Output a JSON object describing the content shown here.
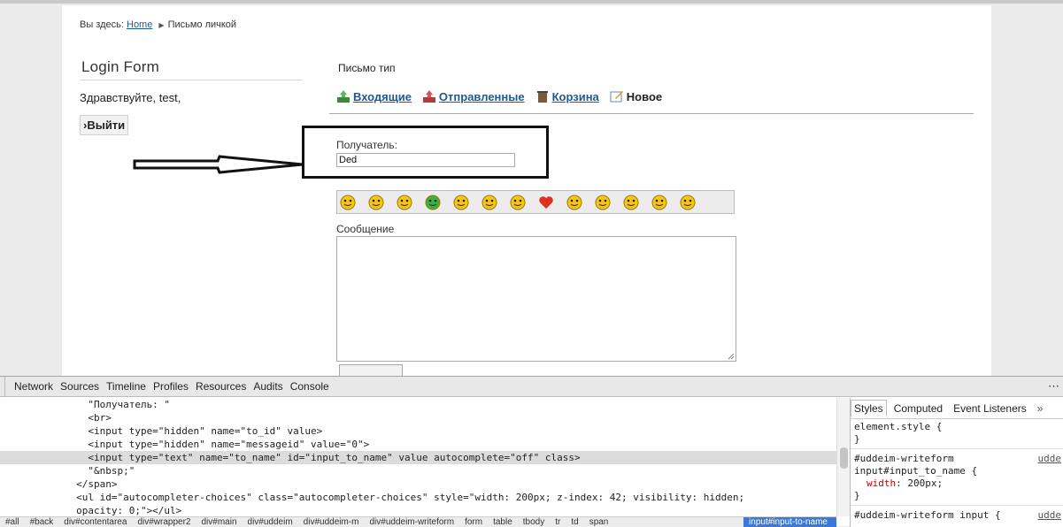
{
  "breadcrumb": {
    "prefix": "Вы здесь:",
    "home": "Home",
    "current": "Письмо личкой"
  },
  "login": {
    "title": "Login Form",
    "greeting": "Здравствуйте, test,",
    "logout": "›Выйти"
  },
  "message": {
    "type_label": "Письмо тип",
    "nav": {
      "inbox": "Входящие",
      "sent": "Отправленные",
      "trash": "Корзина",
      "new": "Новое"
    },
    "recipient_label": "Получатель:",
    "recipient_value": "Ded",
    "body_label": "Сообщение",
    "smileys": [
      "smile-face-icon",
      "wink-face-icon",
      "grin-face-icon",
      "green-alien-face-icon",
      "angry-face-icon",
      "sad-face-icon",
      "cool-sunglasses-face-icon",
      "heart-icon",
      "blush-face-icon",
      "thinking-face-icon",
      "surprised-face-icon",
      "happy-face-icon",
      "sleepy-face-icon"
    ]
  },
  "devtools": {
    "tabs": [
      "Network",
      "Sources",
      "Timeline",
      "Profiles",
      "Resources",
      "Audits",
      "Console"
    ],
    "elements": [
      {
        "indent": "               ",
        "text": "\"Получатель: \""
      },
      {
        "indent": "               ",
        "text": "<br>"
      },
      {
        "indent": "               ",
        "text": "<input type=\"hidden\" name=\"to_id\" value>"
      },
      {
        "indent": "               ",
        "text": "<input type=\"hidden\" name=\"messageid\" value=\"0\">"
      },
      {
        "indent": "               ",
        "text": "<input type=\"text\" name=\"to_name\" id=\"input_to_name\" value autocomplete=\"off\" class>"
      },
      {
        "indent": "               ",
        "text": "\"&nbsp;\""
      },
      {
        "indent": "             ",
        "text": "</span>"
      },
      {
        "indent": "             ",
        "text": "<ul id=\"autocompleter-choices\" class=\"autocompleter-choices\" style=\"width: 200px; z-index: 42; visibility: hidden;"
      },
      {
        "indent": "             ",
        "text": "opacity: 0;\"></ul>"
      }
    ],
    "crumbs": [
      "#all",
      "#back",
      "div#contentarea",
      "div#wrapper2",
      "div#main",
      "div#uddeim",
      "div#uddeim-m",
      "div#uddeim-writeform",
      "form",
      "table",
      "tbody",
      "tr",
      "td",
      "span"
    ],
    "crumb_active": "input#input-to-name",
    "styles_tabs": {
      "styles": "Styles",
      "computed": "Computed",
      "listeners": "Event Listeners",
      "more": "»"
    },
    "styles_rules": {
      "element_style": "element.style {",
      "close1": "}",
      "sel1a": "#uddeim-writeform",
      "sel1b": "input#input_to_name {",
      "prop1": "width",
      "val1": " 200px;",
      "close2": "}",
      "sel2": "#uddeim-writeform input {",
      "link1": "udde",
      "link2": "udde"
    }
  }
}
